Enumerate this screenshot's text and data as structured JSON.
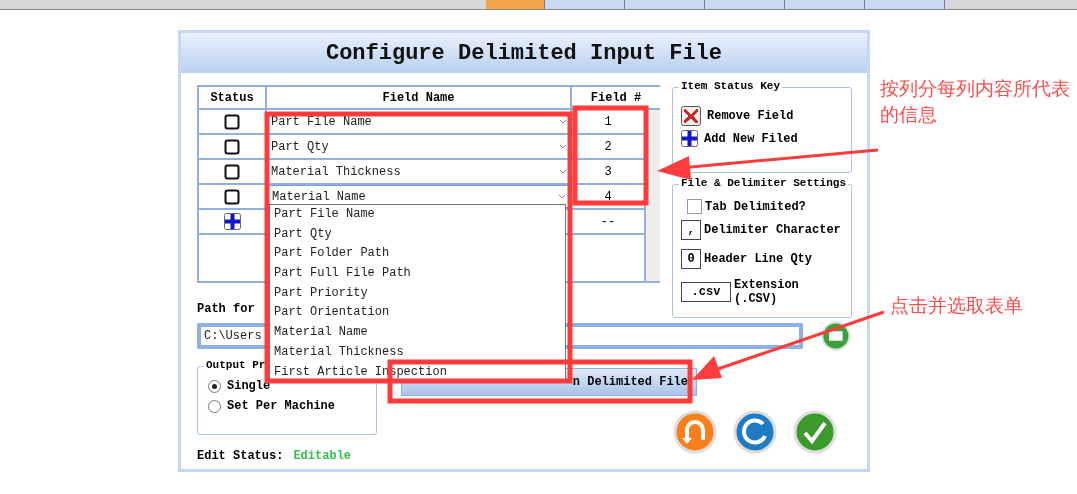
{
  "top_tabs": [
    {
      "selected": true
    },
    {
      "selected": false
    },
    {
      "selected": false
    },
    {
      "selected": false
    },
    {
      "selected": false
    },
    {
      "selected": false
    }
  ],
  "title": "Configure Delimited Input File",
  "grid": {
    "columns": [
      "Status",
      "Field Name",
      "Field #"
    ],
    "rows": [
      {
        "kind": "field",
        "checked": false,
        "field_name": "Part File Name",
        "field_number": "1"
      },
      {
        "kind": "field",
        "checked": false,
        "field_name": "Part Qty",
        "field_number": "2"
      },
      {
        "kind": "field",
        "checked": false,
        "field_name": "Material Thickness",
        "field_number": "3"
      },
      {
        "kind": "field",
        "checked": false,
        "field_name": "Material Name",
        "field_number": "4",
        "expanded": true
      },
      {
        "kind": "add",
        "field_number": "--"
      }
    ]
  },
  "dropdown_options": [
    "Part File Name",
    "Part Qty",
    "Part Folder Path",
    "Part Full File Path",
    "Part Priority",
    "Part Orientation",
    "Material Name",
    "Material Thickness",
    "First Article Inspection"
  ],
  "status_key": {
    "title": "Item Status Key",
    "items": [
      {
        "kind": "remove",
        "label": "Remove Field"
      },
      {
        "kind": "add",
        "label": "Add New Filed"
      }
    ]
  },
  "settings": {
    "title": "File & Delimiter Settings",
    "tab_delimited": {
      "label": "Tab Delimited?",
      "checked": false
    },
    "fields": [
      {
        "value": ",",
        "label": "Delimiter Character"
      },
      {
        "value": "0",
        "label": "Header Line Qty"
      },
      {
        "value": ".csv",
        "label": "Extension (.CSV)"
      }
    ]
  },
  "path": {
    "label": "Path for",
    "value": "C:\\Users"
  },
  "output": {
    "title": "Output Pr",
    "options": [
      {
        "label": "Single",
        "selected": true
      },
      {
        "label": "Set Per Machine",
        "selected": false
      }
    ]
  },
  "open_button": "n Delimited File",
  "edit_status": {
    "label": "Edit Status:",
    "value": "Editable"
  },
  "annotations": [
    "按列分每列内容所代表的信息",
    "点击并选取表单"
  ]
}
